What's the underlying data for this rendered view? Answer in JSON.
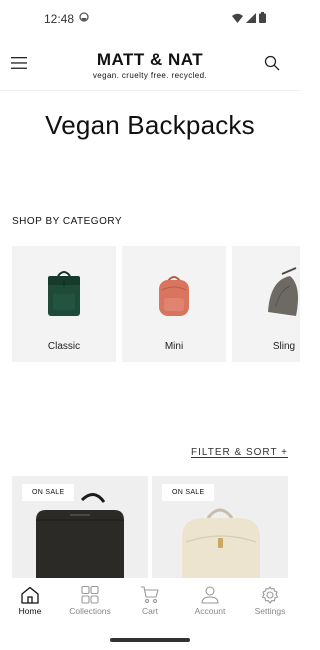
{
  "status": {
    "time": "12:48"
  },
  "header": {
    "brand": "MATT & NAT",
    "tagline": "vegan. cruelty free. recycled."
  },
  "page": {
    "title": "Vegan Backpacks"
  },
  "shop": {
    "label": "SHOP BY CATEGORY",
    "categories": [
      {
        "name": "Classic",
        "color": "#1f4a37"
      },
      {
        "name": "Mini",
        "color": "#d9755e"
      },
      {
        "name": "Sling",
        "color": "#6d6a63"
      }
    ]
  },
  "filter": {
    "label": "FILTER & SORT +"
  },
  "products": [
    {
      "badge": "ON SALE",
      "color": "#2b2a27"
    },
    {
      "badge": "ON SALE",
      "color": "#ede4d0"
    }
  ],
  "nav": {
    "items": [
      {
        "label": "Home",
        "active": true
      },
      {
        "label": "Collections",
        "active": false
      },
      {
        "label": "Cart",
        "active": false
      },
      {
        "label": "Account",
        "active": false
      },
      {
        "label": "Settings",
        "active": false
      }
    ]
  }
}
